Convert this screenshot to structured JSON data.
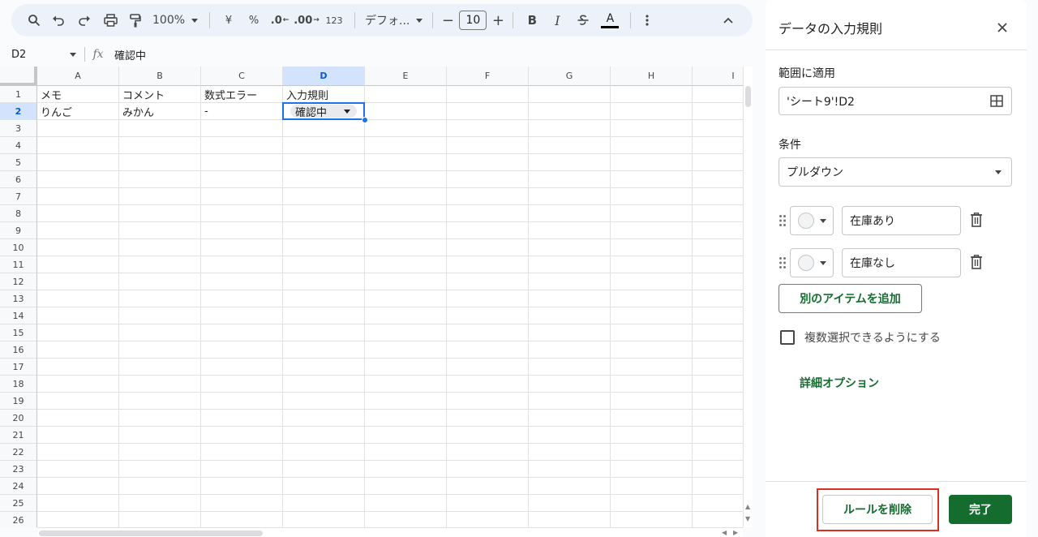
{
  "toolbar": {
    "zoom": "100%",
    "currency": "¥",
    "percent": "%",
    "dec_decrease": ".0",
    "dec_increase": ".00",
    "number_format": "123",
    "font": "デフォ...",
    "font_size": "10",
    "minus": "−",
    "plus": "+",
    "bold": "B",
    "italic": "I",
    "text_color_letter": "A",
    "accent": "#000000"
  },
  "formula_bar": {
    "cell_ref": "D2",
    "fx": "fx",
    "content": "確認中"
  },
  "grid": {
    "columns": [
      "A",
      "B",
      "C",
      "D",
      "E",
      "F",
      "G",
      "H",
      "I"
    ],
    "selected_column": "D",
    "rows": [
      "1",
      "2",
      "3",
      "4",
      "5",
      "6",
      "7",
      "8",
      "9",
      "10",
      "11",
      "12",
      "13",
      "14",
      "15",
      "16",
      "17",
      "18",
      "19",
      "20",
      "21",
      "22",
      "23",
      "24",
      "25",
      "26"
    ],
    "selected_row": "2",
    "header_row": [
      "メモ",
      "コメント",
      "数式エラー",
      "入力規則"
    ],
    "data_row": [
      "りんご",
      "みかん",
      "-"
    ],
    "dropdown_chip": "確認中"
  },
  "panel": {
    "title": "データの入力規則",
    "range_label": "範囲に適用",
    "range_value": "'シート9'!D2",
    "condition_label": "条件",
    "condition_value": "プルダウン",
    "items": [
      {
        "value": "在庫あり"
      },
      {
        "value": "在庫なし"
      }
    ],
    "add_item": "別のアイテムを追加",
    "multi_select": "複数選択できるようにする",
    "advanced": "詳細オプション",
    "delete_rule": "ルールを削除",
    "done": "完了",
    "colors": {
      "brand_green": "#146c2e",
      "highlight_red": "#d93025",
      "select_blue": "#1a73e8"
    }
  }
}
